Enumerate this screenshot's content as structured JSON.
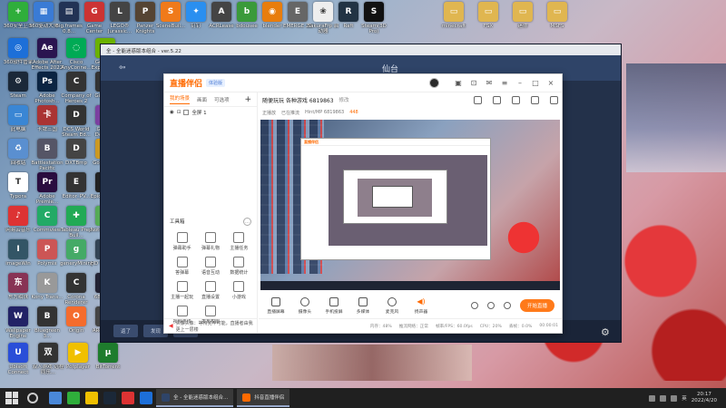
{
  "desktop": {
    "icons": [
      {
        "label": "360安全卫士",
        "color": "#2fae3b",
        "glyph": "+"
      },
      {
        "label": "360驱动大师",
        "color": "#3a7bd5",
        "glyph": "▦"
      },
      {
        "label": "Big.frames 0.8...",
        "color": "#223355",
        "glyph": "▤"
      },
      {
        "label": "Game Center",
        "color": "#c33",
        "glyph": "G"
      },
      {
        "label": "LEGO® Jurassic...",
        "color": "#444",
        "glyph": "L"
      },
      {
        "label": "Panzer Knights",
        "color": "#554433",
        "glyph": "P"
      },
      {
        "label": "SceneBuil...",
        "color": "#f07a1a",
        "glyph": "S"
      },
      {
        "label": "钉钉",
        "color": "#2a8ff0",
        "glyph": "✦"
      },
      {
        "label": "ACRLease",
        "color": "#444",
        "glyph": "A"
      },
      {
        "label": "bdousee",
        "color": "#3a9a3a",
        "glyph": "b"
      },
      {
        "label": "blender",
        "color": "#e87d0d",
        "glyph": "◉"
      },
      {
        "label": "EMERGE 20",
        "color": "#666",
        "glyph": "E"
      },
      {
        "label": "SakuraFrp 启动器",
        "color": "#eee",
        "glyph": "❀"
      },
      {
        "label": "Raft",
        "color": "#234",
        "glyph": "R"
      },
      {
        "label": "Steam(3D Pro)",
        "color": "#111",
        "glyph": "S"
      },
      {
        "label": "minecraft",
        "color": "#e0b650",
        "glyph": "▭"
      },
      {
        "label": "FSX",
        "color": "#e0b650",
        "glyph": "▭"
      },
      {
        "label": "迷你",
        "color": "#e0b650",
        "glyph": "▭"
      },
      {
        "label": "MSFS",
        "color": "#e0b650",
        "glyph": "▭"
      },
      {
        "label": "360软件管家",
        "color": "#1d6fd8",
        "glyph": "◎"
      },
      {
        "label": "Adobe After Effects 2022",
        "color": "#2a1550",
        "glyph": "Ae"
      },
      {
        "label": "Cisco AnyConne...",
        "color": "#0a5",
        "glyph": "◌"
      },
      {
        "label": "GeForce Experience",
        "color": "#6ab100",
        "glyph": "G"
      },
      {
        "label": "Steam",
        "color": "#1b2838",
        "glyph": "⚙"
      },
      {
        "label": "Adobe Photosh...",
        "color": "#0b2442",
        "glyph": "Ps"
      },
      {
        "label": "Company of Heroes 2",
        "color": "#333",
        "glyph": "C"
      },
      {
        "label": "Git Bash",
        "color": "#333",
        "glyph": "◆"
      },
      {
        "label": "此电脑",
        "color": "#3a86d4",
        "glyph": "▭"
      },
      {
        "label": "卡牌三国",
        "color": "#a33",
        "glyph": "卡"
      },
      {
        "label": "DCS World Steam Ed...",
        "color": "#333",
        "glyph": "D"
      },
      {
        "label": "GitHub Desktop",
        "color": "#7b3fa0",
        "glyph": "◐"
      },
      {
        "label": "回收站",
        "color": "#5a8fd0",
        "glyph": "♻"
      },
      {
        "label": "Battlestation Pacific",
        "color": "#556",
        "glyph": "B"
      },
      {
        "label": "DXTBmp",
        "color": "#444",
        "glyph": "D"
      },
      {
        "label": "GoldWave",
        "color": "#c92",
        "glyph": "W"
      },
      {
        "label": "Typora",
        "color": "#fff",
        "glyph": "T"
      },
      {
        "label": "Adobe Premie...",
        "color": "#2a0d3f",
        "glyph": "Pr"
      },
      {
        "label": "Editor_PV...",
        "color": "#333",
        "glyph": "E"
      },
      {
        "label": "Epic Games",
        "color": "#222",
        "glyph": "E"
      },
      {
        "label": "网易云音乐",
        "color": "#d33",
        "glyph": "♪"
      },
      {
        "label": "Commview",
        "color": "#2a6",
        "glyph": "C"
      },
      {
        "label": "Tableau Prep Buil...",
        "color": "#2a5",
        "glyph": "✚"
      },
      {
        "label": "Notepad++",
        "color": "#5a5",
        "glyph": "N"
      },
      {
        "label": "imageWin",
        "color": "#356",
        "glyph": "I"
      },
      {
        "label": "Polymix",
        "color": "#c55",
        "glyph": "P"
      },
      {
        "label": "generyMining",
        "color": "#4a6",
        "glyph": "g"
      },
      {
        "label": "HD VIDEO...",
        "color": "#345",
        "glyph": "H"
      },
      {
        "label": "东方绀珠",
        "color": "#835",
        "glyph": "东"
      },
      {
        "label": "Kony Trans...",
        "color": "#999",
        "glyph": "K"
      },
      {
        "label": "Corona Renderer",
        "color": "#333",
        "glyph": "C"
      },
      {
        "label": "6819863",
        "color": "#223",
        "glyph": "6"
      },
      {
        "label": "Wallpaper Engine",
        "color": "#226",
        "glyph": "W"
      },
      {
        "label": "Bluegreen 3...",
        "color": "#333",
        "glyph": "B"
      },
      {
        "label": "Origin",
        "color": "#f56c2d",
        "glyph": "O"
      },
      {
        "label": "AReview...",
        "color": "#444",
        "glyph": "A"
      },
      {
        "label": "Ubisoft Connect",
        "color": "#2a4ed8",
        "glyph": "U"
      },
      {
        "label": "双人游戏 远程同乐...",
        "color": "#333",
        "glyph": "双"
      },
      {
        "label": "Potplayer",
        "color": "#f0c000",
        "glyph": "▶"
      },
      {
        "label": "BitTorrent",
        "color": "#1e7c2d",
        "glyph": "µ"
      }
    ]
  },
  "bg_window": {
    "title": "全 - 全能迷惑版本组合 - ver.5.22",
    "nav_city": "仙台",
    "bottom_buttons": [
      "返了",
      "发现",
      "更多"
    ]
  },
  "app": {
    "logo": "直播伴侣",
    "logo_badge": "体验版",
    "left_tabs": [
      {
        "label": "我的场景",
        "active": true
      },
      {
        "label": "画面",
        "active": false
      },
      {
        "label": "可选项",
        "active": false
      }
    ],
    "add_label": "+",
    "scene_item": "全屏 1",
    "tools_title": "工具箱",
    "tools": [
      "弹幕助手",
      "弹幕礼物",
      "主播任务",
      "答弹幕",
      "语音互动",
      "数据统计",
      "主播一起玩",
      "直播设置",
      "小游戏",
      "视频连线",
      "发布权限"
    ],
    "notice": "头像头像：等待完毕可能，直播者由我 更上一层楼",
    "room_title": "随便玩玩 各种游戏 6819863",
    "room_edit": "修改",
    "meta": [
      "正播放",
      "已在推流",
      "Hint/MP 6819863",
      "448"
    ],
    "controls": [
      "直播屏幕",
      "摄像头",
      "手机投屏",
      "多媒体",
      "麦克风",
      "扬声器"
    ],
    "start_button": "开始直播",
    "status": [
      "内存：48%",
      "推流网络：正常",
      "帧率/FPS：60.0fps",
      "CPU：20%",
      "丢帧：0.0%",
      "00:00:01"
    ]
  },
  "taskbar": {
    "running_apps": [
      "全 - 全能迷惑版本组合...",
      "抖音直播伴侣"
    ],
    "tray_lang": "英",
    "clock_time": "20:17",
    "clock_date": "2022/4/20"
  },
  "colors": {
    "accent": "#ff6a00",
    "bg_window": "#23314a",
    "taskbar": "#202020"
  }
}
